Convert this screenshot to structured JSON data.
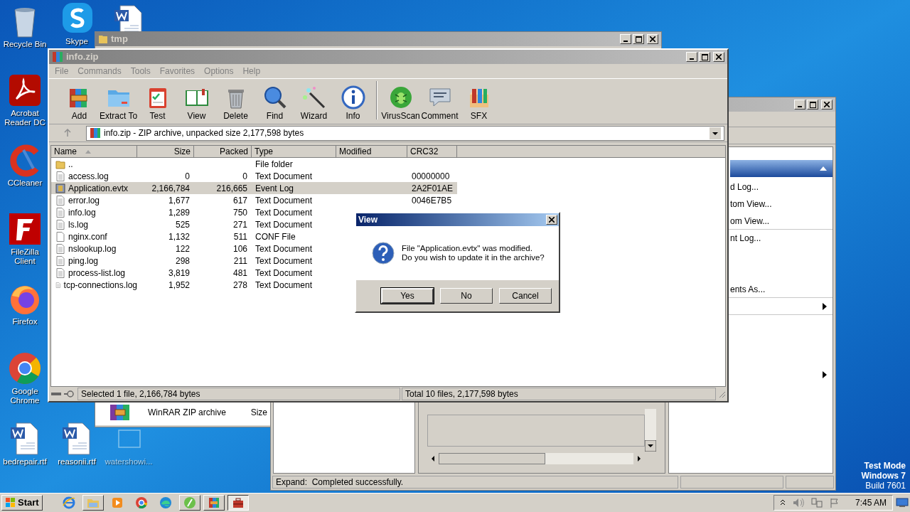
{
  "desktop_icons": [
    {
      "kind": "recycle",
      "label": "Recycle Bin"
    },
    {
      "kind": "skype",
      "label": "Skype"
    },
    {
      "kind": "word"
    },
    {
      "kind": "acrobat",
      "label": "Acrobat Reader DC"
    },
    {
      "kind": "ccleaner",
      "label": "CCleaner"
    },
    {
      "kind": "filezilla",
      "label": "FileZilla Client"
    },
    {
      "kind": "firefox",
      "label": "Firefox"
    },
    {
      "kind": "chrome",
      "label": "Google Chrome"
    },
    {
      "kind": "word",
      "label": "bedrepair.rtf"
    },
    {
      "kind": "word",
      "label": "reasonii.rtf"
    },
    {
      "kind": "ghost",
      "label": "watershowi..."
    }
  ],
  "tmp_window": {
    "title": "tmp",
    "item_type": "WinRAR ZIP archive",
    "item_column": "Size"
  },
  "console_window": {
    "actions": [
      {
        "kind": "text",
        "label": "d Log...",
        "divider_after": false
      },
      {
        "kind": "text",
        "label": "tom View...",
        "divider_after": false
      },
      {
        "kind": "text",
        "label": "om View...",
        "divider_after": true
      },
      {
        "kind": "text",
        "label": "nt Log...",
        "divider_after": false
      },
      {
        "kind": "gap",
        "divider_after": false
      },
      {
        "kind": "gap",
        "divider_after": false
      },
      {
        "kind": "text",
        "label": "ents As...",
        "divider_after": true
      },
      {
        "kind": "submenu",
        "divider_after": true
      },
      {
        "kind": "gap",
        "divider_after": false
      },
      {
        "kind": "gap",
        "divider_after": false
      },
      {
        "kind": "gap",
        "divider_after": false
      },
      {
        "kind": "submenu",
        "divider_after": false
      }
    ],
    "status": "Expand:  Completed successfully."
  },
  "winrar": {
    "title": "info.zip",
    "menu": [
      "File",
      "Commands",
      "Tools",
      "Favorites",
      "Options",
      "Help"
    ],
    "toolbar": [
      {
        "kind": "add",
        "label": "Add"
      },
      {
        "kind": "extract",
        "label": "Extract To"
      },
      {
        "kind": "test",
        "label": "Test"
      },
      {
        "kind": "view",
        "label": "View"
      },
      {
        "kind": "delete",
        "label": "Delete"
      },
      {
        "kind": "find",
        "label": "Find"
      },
      {
        "kind": "wizard",
        "label": "Wizard"
      },
      {
        "kind": "info",
        "label": "Info"
      },
      {
        "kind": "virus",
        "label": "VirusScan"
      },
      {
        "kind": "comment",
        "label": "Comment"
      },
      {
        "kind": "sfx",
        "label": "SFX"
      }
    ],
    "address": "info.zip - ZIP archive, unpacked size 2,177,598 bytes",
    "columns": [
      {
        "label": "Name",
        "sorted": true
      },
      {
        "label": "Size",
        "sorted": false
      },
      {
        "label": "Packed",
        "sorted": false
      },
      {
        "label": "Type",
        "sorted": false
      },
      {
        "label": "Modified",
        "sorted": false
      },
      {
        "label": "CRC32",
        "sorted": false
      }
    ],
    "rows": [
      {
        "kind": "folder",
        "name": "..",
        "type": "File folder",
        "selected": false
      },
      {
        "kind": "text",
        "name": "access.log",
        "size": "0",
        "packed": "0",
        "type": "Text Document",
        "crc32": "00000000",
        "selected": false
      },
      {
        "kind": "evtx",
        "name": "Application.evtx",
        "size": "2,166,784",
        "packed": "216,665",
        "type": "Event Log",
        "crc32": "2A2F01AE",
        "selected": true
      },
      {
        "kind": "text",
        "name": "error.log",
        "size": "1,677",
        "packed": "617",
        "type": "Text Document",
        "crc32": "0046E7B5",
        "selected": false
      },
      {
        "kind": "text",
        "name": "info.log",
        "size": "1,289",
        "packed": "750",
        "type": "Text Document",
        "selected": false
      },
      {
        "kind": "text",
        "name": "ls.log",
        "size": "525",
        "packed": "271",
        "type": "Text Document",
        "selected": false
      },
      {
        "kind": "file",
        "name": "nginx.conf",
        "size": "1,132",
        "packed": "511",
        "type": "CONF File",
        "selected": false
      },
      {
        "kind": "text",
        "name": "nslookup.log",
        "size": "122",
        "packed": "106",
        "type": "Text Document",
        "selected": false
      },
      {
        "kind": "text",
        "name": "ping.log",
        "size": "298",
        "packed": "211",
        "type": "Text Document",
        "selected": false
      },
      {
        "kind": "text",
        "name": "process-list.log",
        "size": "3,819",
        "packed": "481",
        "type": "Text Document",
        "selected": false
      },
      {
        "kind": "text",
        "name": "tcp-connections.log",
        "size": "1,952",
        "packed": "278",
        "type": "Text Document",
        "selected": false
      }
    ],
    "status_left": "Selected 1 file, 2,166,784 bytes",
    "status_right": "Total 10 files, 2,177,598 bytes"
  },
  "dialog": {
    "title": "View",
    "message": [
      "File \"Application.evtx\" was modified.",
      "Do you wish to update it in the archive?"
    ],
    "buttons": [
      {
        "label": "Yes",
        "default": true
      },
      {
        "label": "No",
        "default": false
      },
      {
        "label": "Cancel",
        "default": false
      }
    ]
  },
  "test_mode": [
    "Test Mode",
    "Windows 7",
    "Build 7601"
  ],
  "taskbar": {
    "start": "Start",
    "apps": [
      {
        "kind": "ie",
        "open": false,
        "active": false
      },
      {
        "kind": "explorer",
        "open": true,
        "active": false
      },
      {
        "kind": "media",
        "open": false,
        "active": false
      },
      {
        "kind": "chrome",
        "open": false,
        "active": false
      },
      {
        "kind": "edge",
        "open": false,
        "active": false
      },
      {
        "kind": "leaf",
        "open": true,
        "active": false
      },
      {
        "kind": "winrar",
        "open": true,
        "active": false
      },
      {
        "kind": "toolbox",
        "open": true,
        "active": true
      }
    ],
    "clock": "7:45 AM"
  }
}
